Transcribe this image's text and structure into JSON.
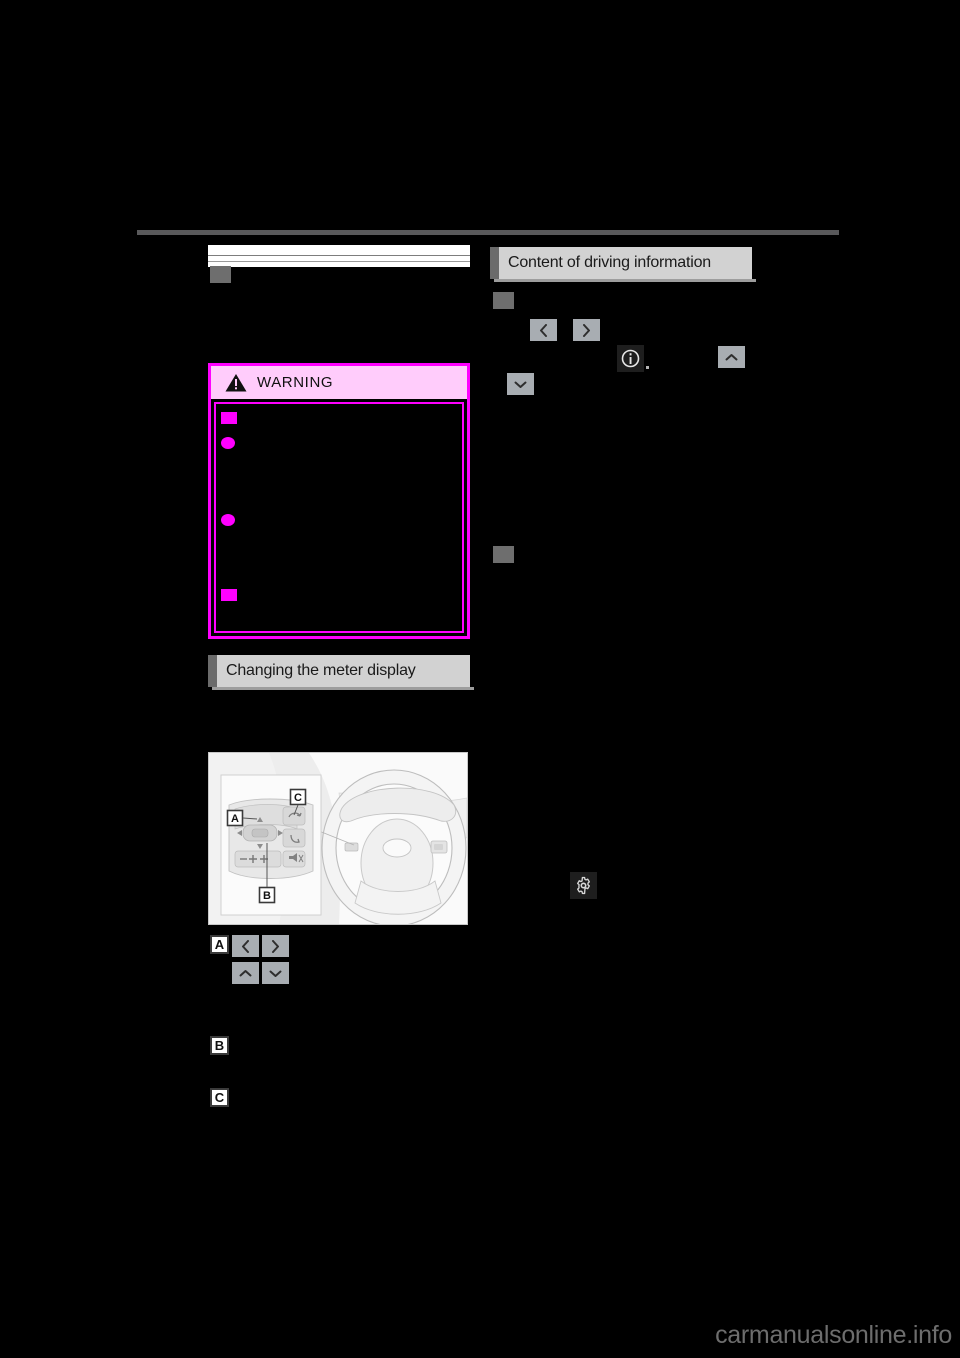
{
  "page": {
    "background_color": "#000000",
    "watermark": "carmanualsonline.info"
  },
  "left_column": {
    "subsection_heading_bullet": "square-bullet",
    "warning": {
      "title": "WARNING",
      "icon": "warning-triangle-icon",
      "border_color": "#ff00ff",
      "header_background": "#ffccfb",
      "bullets": [
        {
          "type": "square"
        },
        {
          "type": "round"
        },
        {
          "type": "round"
        },
        {
          "type": "square"
        }
      ]
    },
    "section_heading": "Changing the meter display",
    "illustration": {
      "name": "steering-wheel-switch-illustration",
      "callouts": [
        "A",
        "B",
        "C"
      ]
    },
    "callouts": [
      {
        "letter": "A",
        "keys": [
          {
            "icon": "chevron-left-icon",
            "glyph": "<"
          },
          {
            "icon": "chevron-right-icon",
            "glyph": ">"
          },
          {
            "icon": "chevron-up-icon",
            "glyph": "^"
          },
          {
            "icon": "chevron-down-icon",
            "glyph": "v"
          }
        ]
      },
      {
        "letter": "B",
        "keys": []
      },
      {
        "letter": "C",
        "keys": []
      }
    ]
  },
  "right_column": {
    "section_heading": "Content of driving information",
    "subsection_bullets": [
      "square-bullet",
      "square-bullet"
    ],
    "keys": [
      {
        "icon": "chevron-left-icon",
        "glyph": "<"
      },
      {
        "icon": "chevron-right-icon",
        "glyph": ">"
      },
      {
        "icon": "chevron-up-icon",
        "glyph": "^"
      },
      {
        "icon": "chevron-down-icon",
        "glyph": "v"
      }
    ],
    "icons": [
      {
        "name": "information-icon",
        "glyph": "i"
      },
      {
        "name": "settings-gear-icon",
        "glyph": "gear"
      }
    ]
  }
}
